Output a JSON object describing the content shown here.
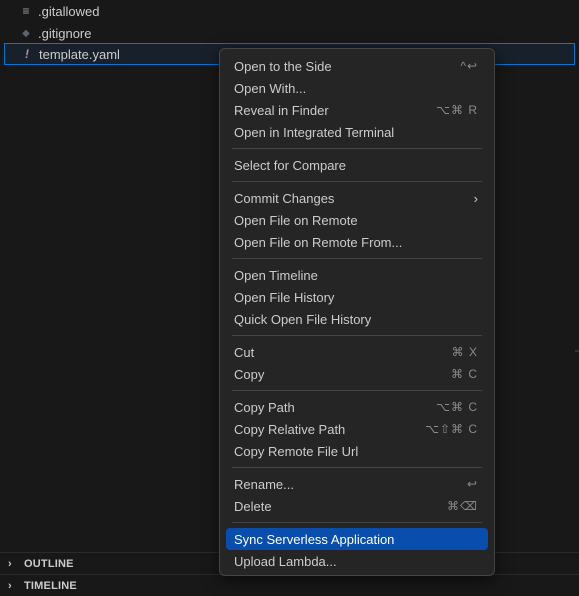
{
  "explorer": {
    "files": [
      {
        "name": ".gitallowed",
        "icon": "lines-icon"
      },
      {
        "name": ".gitignore",
        "icon": "diamond-icon"
      },
      {
        "name": "template.yaml",
        "icon": "exclamation-icon"
      }
    ]
  },
  "panels": {
    "outline": "OUTLINE",
    "timeline": "TIMELINE"
  },
  "icons": {
    "lines": "≡",
    "diamond": "◆",
    "bang": "!",
    "chevron_right": "›"
  },
  "context_menu": {
    "items": [
      {
        "label": "Open to the Side",
        "shortcut": "^↩"
      },
      {
        "label": "Open With...",
        "shortcut": ""
      },
      {
        "label": "Reveal in Finder",
        "shortcut": "⌥⌘ R"
      },
      {
        "label": "Open in Integrated Terminal",
        "shortcut": ""
      },
      {
        "label": "Select for Compare",
        "shortcut": ""
      },
      {
        "label": "Commit Changes",
        "shortcut": "",
        "submenu": true
      },
      {
        "label": "Open File on Remote",
        "shortcut": ""
      },
      {
        "label": "Open File on Remote From...",
        "shortcut": ""
      },
      {
        "label": "Open Timeline",
        "shortcut": ""
      },
      {
        "label": "Open File History",
        "shortcut": ""
      },
      {
        "label": "Quick Open File History",
        "shortcut": ""
      },
      {
        "label": "Cut",
        "shortcut": "⌘ X"
      },
      {
        "label": "Copy",
        "shortcut": "⌘ C"
      },
      {
        "label": "Copy Path",
        "shortcut": "⌥⌘ C"
      },
      {
        "label": "Copy Relative Path",
        "shortcut": "⌥⇧⌘ C"
      },
      {
        "label": "Copy Remote File Url",
        "shortcut": ""
      },
      {
        "label": "Rename...",
        "shortcut": "↩"
      },
      {
        "label": "Delete",
        "shortcut": "⌘⌫"
      },
      {
        "label": "Sync Serverless Application",
        "shortcut": "",
        "highlighted": true
      },
      {
        "label": "Upload Lambda...",
        "shortcut": ""
      }
    ]
  },
  "colors": {
    "background": "#181818",
    "menu_background": "#252526",
    "highlight": "#0a4ead",
    "selection_border": "#0078d4"
  }
}
